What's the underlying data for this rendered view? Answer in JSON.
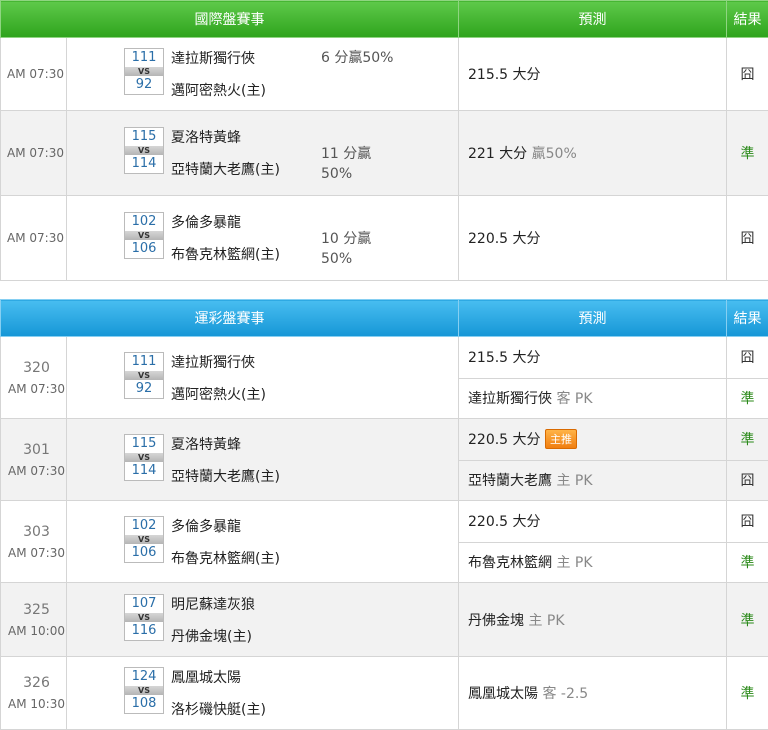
{
  "intl": {
    "header": {
      "match": "國際盤賽事",
      "prediction": "預測",
      "result": "結果"
    },
    "rows": [
      {
        "time": "AM 07:30",
        "away_score": "111",
        "home_score": "92",
        "away": "達拉斯獨行俠",
        "home": "邁阿密熱火(主)",
        "handicap_line1": "6 分贏50%",
        "handicap_line2": "",
        "pred_main": "215.5 大分",
        "pred_sub": "",
        "result": "囧",
        "result_kind": "lose"
      },
      {
        "time": "AM 07:30",
        "away_score": "115",
        "home_score": "114",
        "away": "夏洛特黃蜂",
        "home": "亞特蘭大老鷹(主)",
        "handicap_line1": "11 分贏",
        "handicap_line2": "50%",
        "pred_main": "221 大分",
        "pred_sub": "贏50%",
        "result": "準",
        "result_kind": "win"
      },
      {
        "time": "AM 07:30",
        "away_score": "102",
        "home_score": "106",
        "away": "多倫多暴龍",
        "home": "布魯克林籃網(主)",
        "handicap_line1": "10 分贏",
        "handicap_line2": "50%",
        "pred_main": "220.5 大分",
        "pred_sub": "",
        "result": "囧",
        "result_kind": "lose"
      }
    ]
  },
  "lottery": {
    "header": {
      "match": "運彩盤賽事",
      "prediction": "預測",
      "result": "結果"
    },
    "vs_label": "VS",
    "rows": [
      {
        "code": "320",
        "time": "AM 07:30",
        "away_score": "111",
        "home_score": "92",
        "away": "達拉斯獨行俠",
        "home": "邁阿密熱火(主)",
        "preds": [
          {
            "main": "215.5 大分",
            "sub": "",
            "badge": "",
            "result": "囧",
            "kind": "lose"
          },
          {
            "main": "達拉斯獨行俠",
            "sub": "客 PK",
            "badge": "",
            "result": "準",
            "kind": "win"
          }
        ]
      },
      {
        "code": "301",
        "time": "AM 07:30",
        "away_score": "115",
        "home_score": "114",
        "away": "夏洛特黃蜂",
        "home": "亞特蘭大老鷹(主)",
        "preds": [
          {
            "main": "220.5 大分",
            "sub": "",
            "badge": "主推",
            "result": "準",
            "kind": "win"
          },
          {
            "main": "亞特蘭大老鷹",
            "sub": "主 PK",
            "badge": "",
            "result": "囧",
            "kind": "lose"
          }
        ]
      },
      {
        "code": "303",
        "time": "AM 07:30",
        "away_score": "102",
        "home_score": "106",
        "away": "多倫多暴龍",
        "home": "布魯克林籃網(主)",
        "preds": [
          {
            "main": "220.5 大分",
            "sub": "",
            "badge": "",
            "result": "囧",
            "kind": "lose"
          },
          {
            "main": "布魯克林籃網",
            "sub": "主 PK",
            "badge": "",
            "result": "準",
            "kind": "win"
          }
        ]
      },
      {
        "code": "325",
        "time": "AM 10:00",
        "away_score": "107",
        "home_score": "116",
        "away": "明尼蘇達灰狼",
        "home": "丹佛金塊(主)",
        "preds": [
          {
            "main": "丹佛金塊",
            "sub": "主 PK",
            "badge": "",
            "result": "準",
            "kind": "win"
          }
        ]
      },
      {
        "code": "326",
        "time": "AM 10:30",
        "away_score": "124",
        "home_score": "108",
        "away": "鳳凰城太陽",
        "home": "洛杉磯快艇(主)",
        "preds": [
          {
            "main": "鳳凰城太陽",
            "sub": "客 -2.5",
            "badge": "",
            "result": "準",
            "kind": "win"
          }
        ]
      }
    ]
  },
  "colors": {
    "intl_header": "#2ea31c",
    "lottery_header": "#1596d6",
    "win": "#2b8a1a",
    "score": "#2a6ea8",
    "badge": "#f07e10"
  }
}
